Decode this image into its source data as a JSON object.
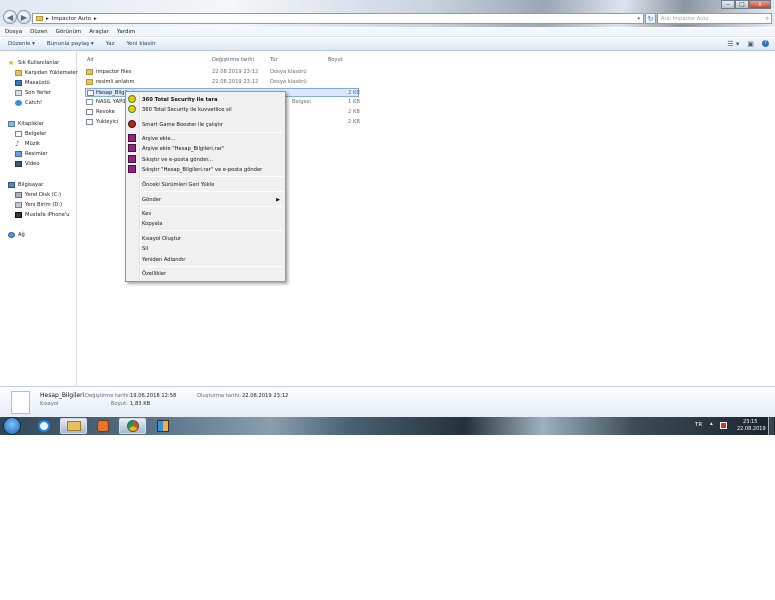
{
  "window": {
    "breadcrumb": [
      "Impactor Auto"
    ],
    "search_placeholder": "Ara: Impactor Auto",
    "controls": [
      "–",
      "□",
      "x"
    ]
  },
  "menubar": [
    "Dosya",
    "Düzen",
    "Görünüm",
    "Araçlar",
    "Yardım"
  ],
  "cmdbar": [
    "Düzenle ▾",
    "Bununla paylaş ▾",
    "Yaz",
    "Yeni klasör"
  ],
  "navpane": {
    "favorites_header": "Sık Kullanılanlar",
    "favorites": [
      "Karşıdan Yüklemeler",
      "Masaüstü",
      "Son Yerler",
      "Catch!"
    ],
    "libraries_header": "Kitaplıklar",
    "libraries": [
      "Belgeler",
      "Müzik",
      "Resimler",
      "Video"
    ],
    "computer_header": "Bilgisayar",
    "drives": [
      "Yerel Disk (C:)",
      "Yeni Birim (D:)",
      "Mustafa iPhone'u"
    ],
    "network": "Ağ"
  },
  "columns": {
    "name": "Ad",
    "date": "Değiştirme tarihi",
    "type": "Tür",
    "size": "Boyut"
  },
  "files": [
    {
      "name": "impactor files",
      "date": "22.08.2019 23:12",
      "type": "Dosya klasörü",
      "size": ""
    },
    {
      "name": "resimli anlatım",
      "date": "22.08.2019 23:12",
      "type": "Dosya klasörü",
      "size": ""
    },
    {
      "name": "Hesap_Bilgileri",
      "date": "",
      "type": "",
      "size": "2 KB"
    },
    {
      "name": "NASIL YAPILIR",
      "date": "",
      "type": "Belgesi",
      "size": "1 KB"
    },
    {
      "name": "Revoke",
      "date": "",
      "type": "",
      "size": "2 KB"
    },
    {
      "name": "Yukleyici",
      "date": "",
      "type": "",
      "size": "2 KB"
    }
  ],
  "context_menu": {
    "items": [
      "360 Total Security ile tara",
      "360 Total Security ile kuvvetlice sil",
      "Smart Game Booster ile çalıştır",
      "Arşive ekle...",
      "Arşive ekle \"Hesap_Bilgileri.rar\"",
      "Sıkıştır ve e-posta gönder...",
      "Sıkıştır \"Hesap_Bilgileri.rar\" ve e-posta gönder",
      "Önceki Sürümleri Geri Yükle",
      "Gönder",
      "Kes",
      "Kopyala",
      "Kısayol Oluştur",
      "Sil",
      "Yeniden Adlandır",
      "Özellikler"
    ],
    "submenu_arrow": "▶"
  },
  "details": {
    "name": "Hesap_Bilgileri",
    "kind": "Kısayol",
    "modified_label": "Değiştirme tarihi:",
    "modified": "19.06.2018 12:58",
    "created_label": "Oluşturma tarihi:",
    "created": "22.08.2019 23:12",
    "size_label": "Boyut:",
    "size": "1,83 KB"
  },
  "tray": {
    "lang": "TR",
    "time": "23:15",
    "date": "22.08.2019"
  },
  "colors": {
    "selection": "#d9e8fb",
    "menu_bg": "#f0f0f0",
    "link": "#1e395b"
  }
}
